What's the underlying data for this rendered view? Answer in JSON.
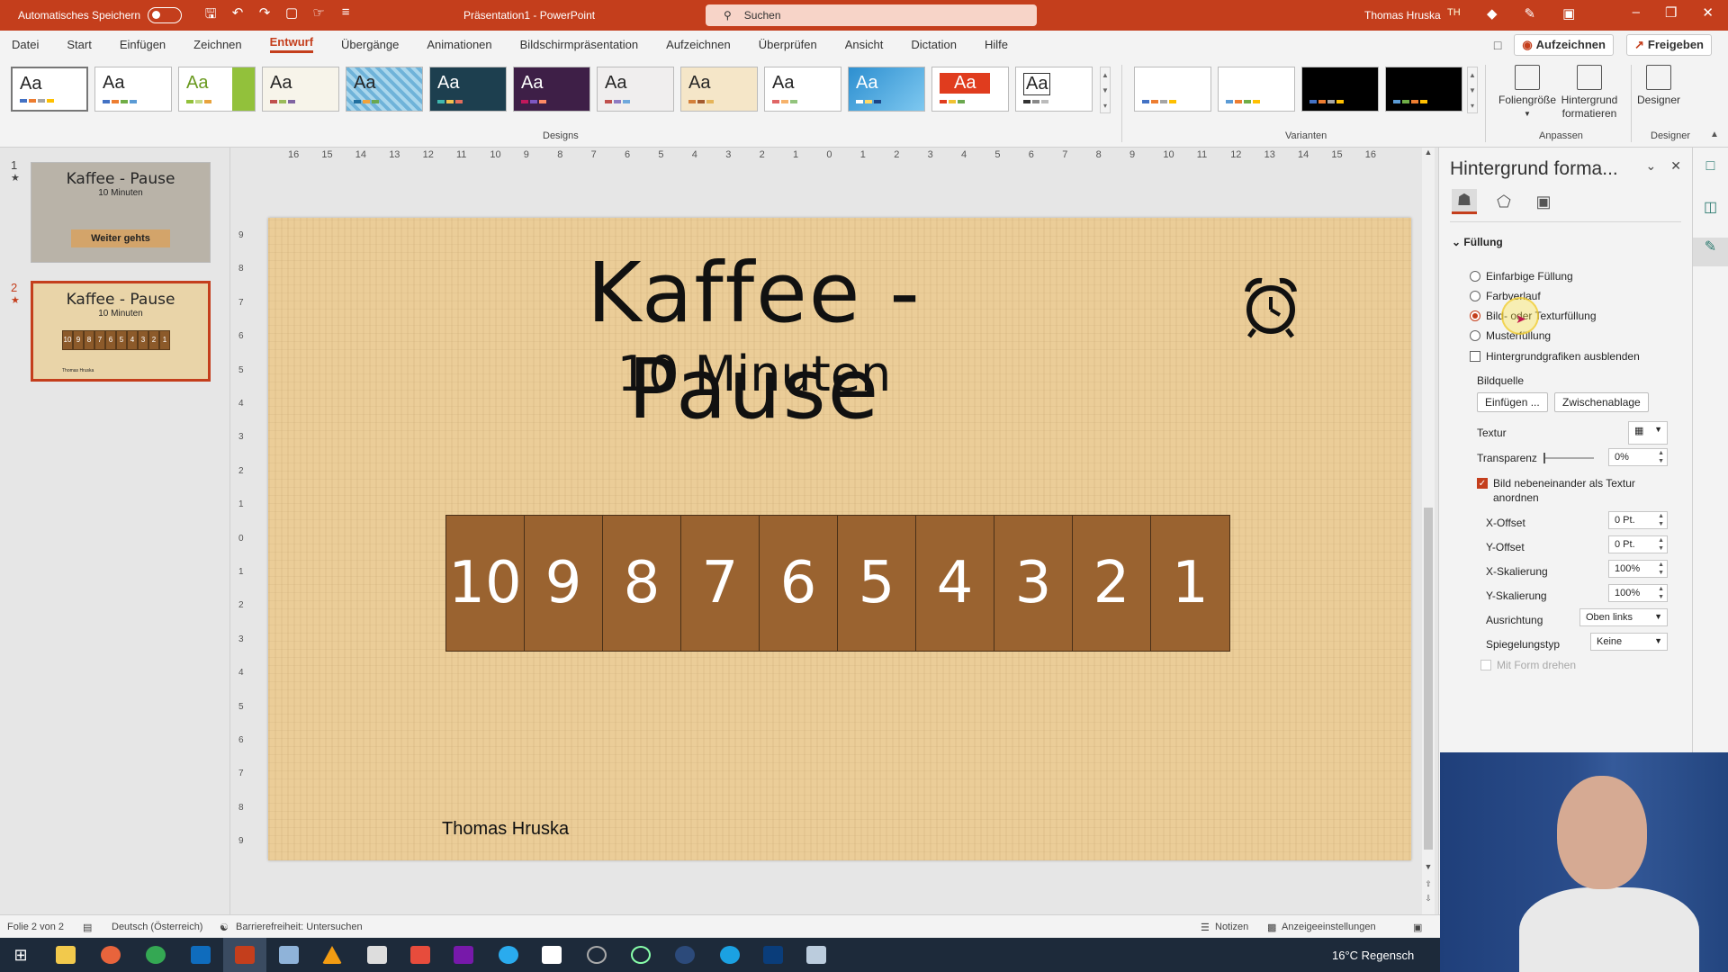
{
  "titlebar": {
    "autosave_label": "Automatisches Speichern",
    "doc_title": "Präsentation1  -  PowerPoint",
    "search_placeholder": "Suchen",
    "user_name": "Thomas Hruska",
    "user_initials": "TH"
  },
  "tabs": [
    "Datei",
    "Start",
    "Einfügen",
    "Zeichnen",
    "Entwurf",
    "Übergänge",
    "Animationen",
    "Bildschirmpräsentation",
    "Aufzeichnen",
    "Überprüfen",
    "Ansicht",
    "Dictation",
    "Hilfe"
  ],
  "active_tab": "Entwurf",
  "tab_actions": {
    "record": "Aufzeichnen",
    "share": "Freigeben"
  },
  "ribbon": {
    "theme_label": "Aa",
    "designs_group": "Designs",
    "variants_group": "Varianten",
    "customize_group": "Anpassen",
    "designer_group": "Designer",
    "slide_size": "Foliengröße",
    "format_background_l1": "Hintergrund",
    "format_background_l2": "formatieren",
    "designer": "Designer"
  },
  "slides": [
    {
      "number": "1",
      "title": "Kaffee - Pause",
      "subtitle": "10 Minuten",
      "banner": "Weiter gehts"
    },
    {
      "number": "2",
      "title": "Kaffee - Pause",
      "subtitle": "10 Minuten"
    }
  ],
  "slide": {
    "title": "Kaffee - Pause",
    "subtitle": "10 Minuten",
    "countdown": [
      "10",
      "9",
      "8",
      "7",
      "6",
      "5",
      "4",
      "3",
      "2",
      "1"
    ],
    "author": "Thomas Hruska",
    "bg_color": "#ebcd98",
    "box_color": "#9a6330"
  },
  "ruler_h": [
    "16",
    "15",
    "14",
    "13",
    "12",
    "11",
    "10",
    "9",
    "8",
    "7",
    "6",
    "5",
    "4",
    "3",
    "2",
    "1",
    "0",
    "1",
    "2",
    "3",
    "4",
    "5",
    "6",
    "7",
    "8",
    "9",
    "10",
    "11",
    "12",
    "13",
    "14",
    "15",
    "16"
  ],
  "ruler_v": [
    "9",
    "8",
    "7",
    "6",
    "5",
    "4",
    "3",
    "2",
    "1",
    "0",
    "1",
    "2",
    "3",
    "4",
    "5",
    "6",
    "7",
    "8",
    "9"
  ],
  "pane": {
    "title": "Hintergrund forma...",
    "fill_section": "Füllung",
    "fill_options": [
      "Einfarbige Füllung",
      "Farbverlauf",
      "Bild- oder Texturfüllung",
      "Musterfüllung"
    ],
    "selected_fill": "Bild- oder Texturfüllung",
    "hide_bg_graphics": "Hintergrundgrafiken ausblenden",
    "image_source": "Bildquelle",
    "insert_btn": "Einfügen ...",
    "clipboard_btn": "Zwischenablage",
    "texture": "Textur",
    "transparency": "Transparenz",
    "transparency_value": "0%",
    "tile_label_l1": "Bild nebeneinander als Textur",
    "tile_label_l2": "anordnen",
    "x_offset": "X-Offset",
    "x_offset_value": "0 Pt.",
    "y_offset": "Y-Offset",
    "y_offset_value": "0 Pt.",
    "x_scale": "X-Skalierung",
    "x_scale_value": "100%",
    "y_scale": "Y-Skalierung",
    "y_scale_value": "100%",
    "alignment": "Ausrichtung",
    "alignment_value": "Oben links",
    "mirror": "Spiegelungstyp",
    "mirror_value": "Keine",
    "rotate_with_shape": "Mit Form drehen"
  },
  "statusbar": {
    "slide_info": "Folie 2 von 2",
    "language": "Deutsch (Österreich)",
    "accessibility": "Barrierefreiheit: Untersuchen",
    "notes": "Notizen",
    "display_settings": "Anzeigeeinstellungen"
  },
  "taskbar": {
    "weather": "16°C  Regensch"
  },
  "colors": {
    "accent": "#c43e1c",
    "titlebar": "#c43e1c"
  }
}
